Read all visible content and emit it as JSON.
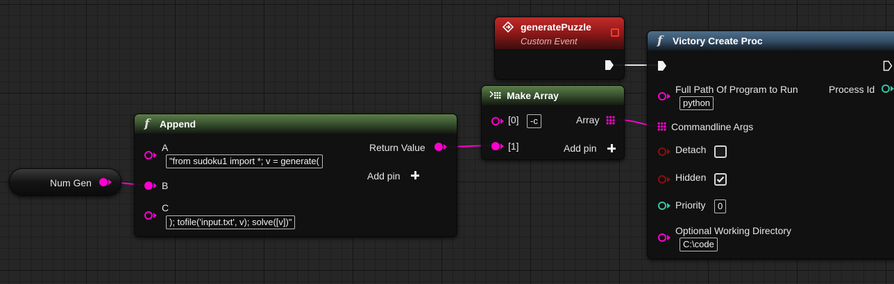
{
  "nodes": {
    "num_gen": {
      "label": "Num Gen"
    },
    "append": {
      "title": "Append",
      "pins": {
        "a": {
          "label": "A",
          "value": "\"from sudoku1 import *; v = generate("
        },
        "b": {
          "label": "B"
        },
        "c": {
          "label": "C",
          "value": "); tofile('input.txt', v); solve([v])\""
        }
      },
      "return_value": "Return Value",
      "add_pin": "Add pin"
    },
    "make_array": {
      "title": "Make Array",
      "pins": [
        {
          "label": "[0]",
          "value": "-c"
        },
        {
          "label": "[1]"
        }
      ],
      "output": "Array",
      "add_pin": "Add pin"
    },
    "generate_puzzle": {
      "title": "generatePuzzle",
      "subtitle": "Custom Event"
    },
    "victory": {
      "title": "Victory Create Proc",
      "full_path": {
        "label": "Full Path Of Program to Run",
        "value": "python"
      },
      "process_id": "Process Id",
      "commandline_args": "Commandline Args",
      "detach": {
        "label": "Detach",
        "checked": false
      },
      "hidden": {
        "label": "Hidden",
        "checked": true
      },
      "priority": {
        "label": "Priority",
        "value": "0"
      },
      "working_dir": {
        "label": "Optional Working Directory",
        "value": "C:\\code"
      }
    }
  },
  "colors": {
    "string_pin": "#ff00d0",
    "int_pin": "#36c6a0",
    "bool_pin": "#8a1010",
    "func_header": "#3a5530",
    "call_header": "#35506a",
    "event_header": "#8e1818"
  }
}
